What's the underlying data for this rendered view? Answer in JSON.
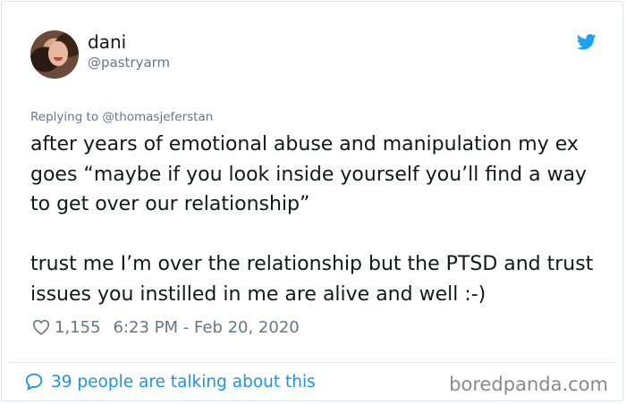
{
  "author": {
    "name": "dani",
    "handle": "@pastryarm"
  },
  "reply": {
    "label": "Replying to @thomasjeferstan"
  },
  "tweet": {
    "text": "after years of emotional abuse and manipulation my ex goes “maybe if you look inside yourself you’ll find a way to get over our relationship”\n\ntrust me I’m over the relationship but the PTSD and trust issues you instilled in me are alive and well :-)",
    "likes": "1,155",
    "timestamp": "6:23 PM - Feb 20, 2020"
  },
  "footer": {
    "talking_label": "39 people are talking about this",
    "watermark": "boredpanda.com"
  },
  "icons": {
    "brand": "twitter-bird-icon",
    "like": "heart-icon",
    "conversation": "speech-bubble-icon"
  },
  "colors": {
    "twitter_blue": "#1da1f2",
    "link_blue": "#1b95e0",
    "muted_text": "#657786",
    "body_text": "#14171a",
    "border": "#e1e8ed",
    "watermark": "#8a8a8a"
  }
}
